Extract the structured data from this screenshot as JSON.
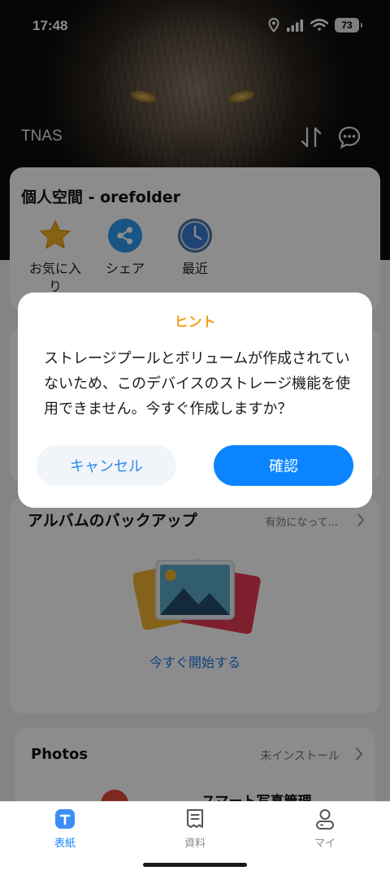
{
  "status_bar": {
    "time": "17:48",
    "battery": "73"
  },
  "header": {
    "title": "TNAS"
  },
  "personal_space": {
    "title": "個人空間 - orefolder",
    "shortcuts": [
      {
        "label": "お気に入り",
        "icon": "star-icon"
      },
      {
        "label": "シェア",
        "icon": "share-icon"
      },
      {
        "label": "最近",
        "icon": "clock-icon"
      }
    ]
  },
  "album_backup": {
    "title": "アルバムのバックアップ",
    "status": "有効になって...",
    "start_label": "今すぐ開始する"
  },
  "photos": {
    "title": "Photos",
    "status": "未インストール",
    "subtitle": "スマート写真管理"
  },
  "dialog": {
    "title": "ヒント",
    "message": "ストレージプールとボリュームが作成されていないため、このデバイスのストレージ機能を使用できません。今すぐ作成しますか？",
    "cancel_label": "キャンセル",
    "confirm_label": "確認"
  },
  "tabs": [
    {
      "label": "表紙",
      "icon": "home-icon",
      "active": true
    },
    {
      "label": "資料",
      "icon": "document-icon",
      "active": false
    },
    {
      "label": "マイ",
      "icon": "profile-icon",
      "active": false
    }
  ],
  "colors": {
    "accent": "#0a84ff",
    "dialog_title": "#f0a020",
    "link": "#1d7be0"
  }
}
